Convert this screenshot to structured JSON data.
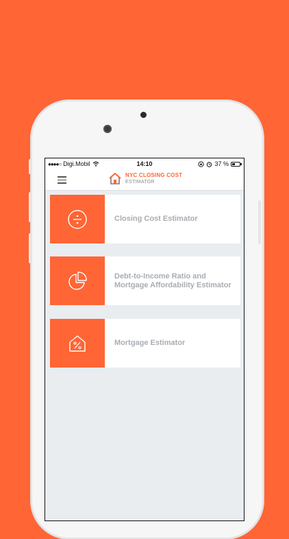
{
  "status_bar": {
    "signal": "●●●●○",
    "carrier": "Digi.Mobil",
    "time": "14:10",
    "battery": "37 %"
  },
  "header": {
    "title": "NYC CLOSING COST",
    "subtitle": "ESTIMATOR"
  },
  "menu": {
    "items": [
      {
        "label": "Closing Cost Estimator",
        "icon": "divide-icon"
      },
      {
        "label": "Debt-to-Income Ratio and Mortgage Affordability Estimator",
        "icon": "pie-chart-icon"
      },
      {
        "label": "Mortgage Estimator",
        "icon": "house-percent-icon"
      }
    ]
  },
  "colors": {
    "accent": "#FF6535",
    "background": "#E9EDF0",
    "label_text": "#A8ADB2"
  }
}
